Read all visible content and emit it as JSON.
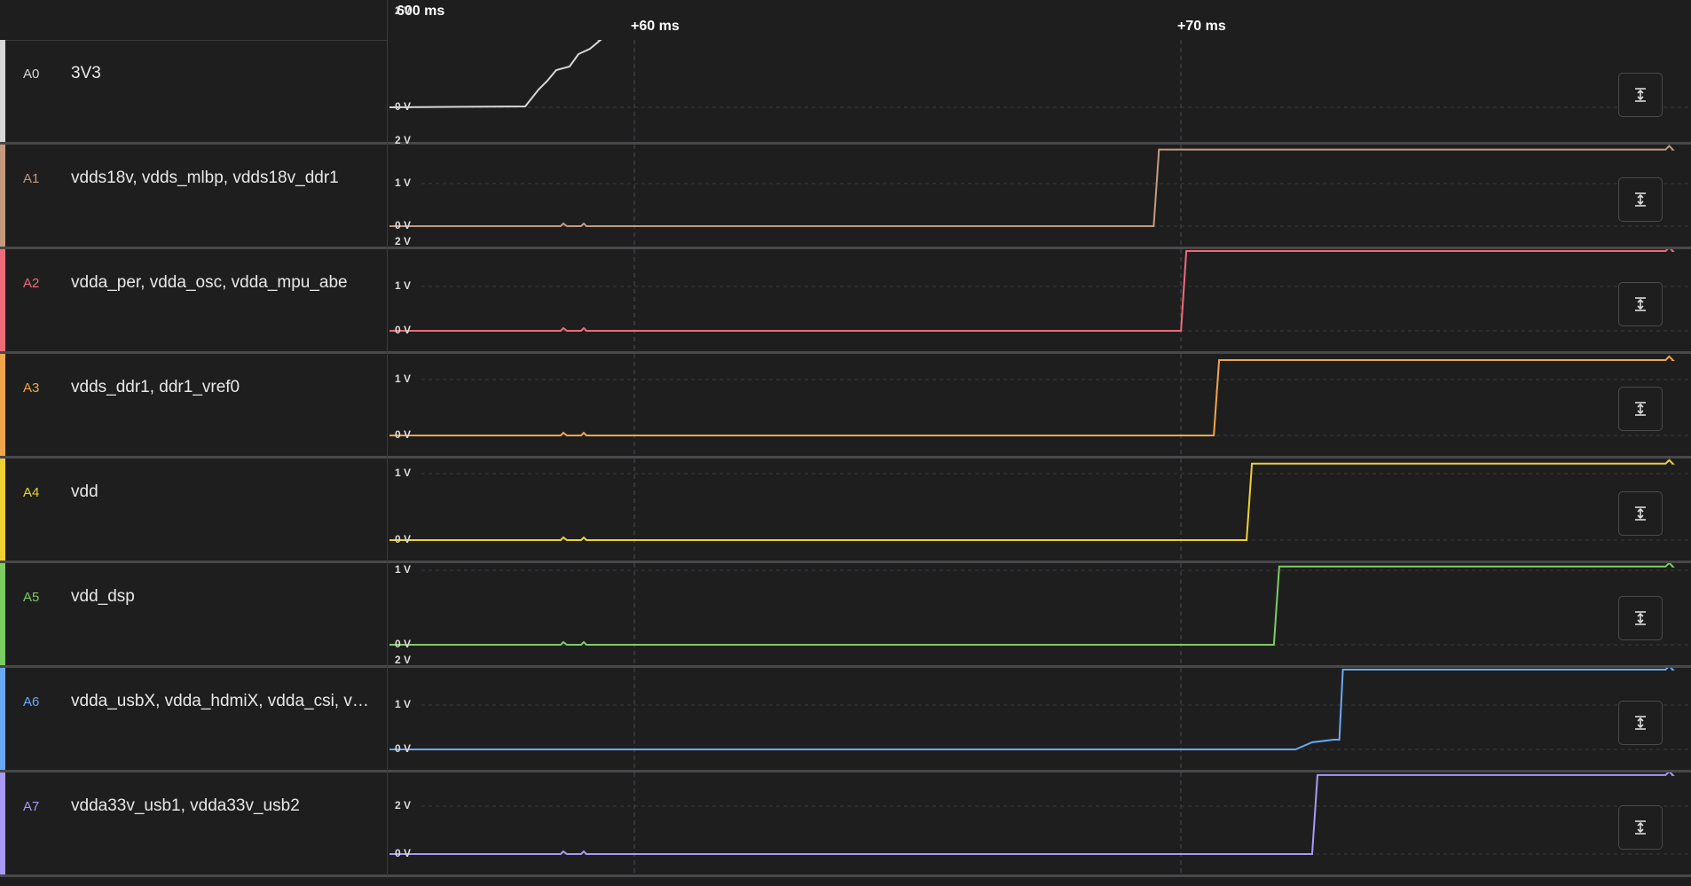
{
  "timeline": {
    "base_label": "600 ms",
    "markers": [
      "+60 ms",
      "+70 ms"
    ]
  },
  "channels": [
    {
      "id": "A0",
      "name": "3V3",
      "color": "#d8d8d8",
      "y_labels": [
        "2 V",
        "0 V"
      ],
      "final_v": 3.3,
      "rise_ms": 52
    },
    {
      "id": "A1",
      "name": "vdds18v, vdds_mlbp, vdds18v_ddr1",
      "color": "#c49a7e",
      "y_labels": [
        "2 V",
        "1 V",
        "0 V"
      ],
      "final_v": 1.8,
      "rise_ms": 69.6
    },
    {
      "id": "A2",
      "name": "vdda_per, vdda_osc, vdda_mpu_abe",
      "color": "#ee6b7a",
      "y_labels": [
        "2 V",
        "1 V",
        "0 V"
      ],
      "final_v": 1.8,
      "rise_ms": 70.1
    },
    {
      "id": "A3",
      "name": "vdds_ddr1, ddr1_vref0",
      "color": "#f0a64a",
      "y_labels": [
        "1 V",
        "0 V"
      ],
      "final_v": 1.35,
      "rise_ms": 70.7
    },
    {
      "id": "A4",
      "name": "vdd",
      "color": "#ecd232",
      "y_labels": [
        "1 V",
        "0 V"
      ],
      "final_v": 1.15,
      "rise_ms": 71.3
    },
    {
      "id": "A5",
      "name": "vdd_dsp",
      "color": "#7ccd62",
      "y_labels": [
        "1 V",
        "0 V"
      ],
      "final_v": 1.05,
      "rise_ms": 71.8
    },
    {
      "id": "A6",
      "name": "vdda_usbX, vdda_hdmiX, vdda_csi, vd…",
      "color": "#6aa9f2",
      "y_labels": [
        "2 V",
        "1 V",
        "0 V"
      ],
      "final_v": 1.8,
      "rise_ms": 72.9
    },
    {
      "id": "A7",
      "name": "vdda33v_usb1, vdda33v_usb2",
      "color": "#a99af3",
      "y_labels": [
        "2 V",
        "0 V"
      ],
      "final_v": 3.3,
      "rise_ms": 72.5
    }
  ],
  "icons": {
    "fit": "fit-vertical-icon"
  }
}
